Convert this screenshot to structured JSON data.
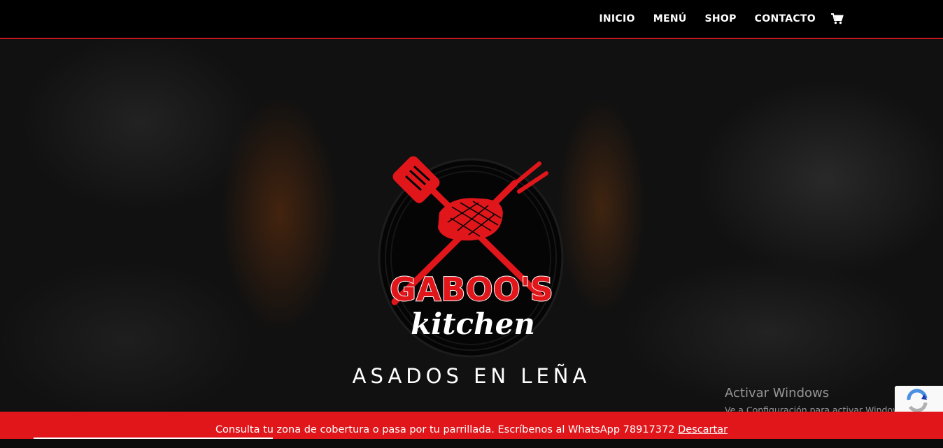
{
  "nav": {
    "items": [
      {
        "label": "INICIO"
      },
      {
        "label": "MENÚ"
      },
      {
        "label": "SHOP"
      },
      {
        "label": "CONTACTO"
      }
    ],
    "cart_icon": "cart-icon"
  },
  "hero": {
    "logo": {
      "brand_line1": "GABOO'S",
      "brand_line2": "kitchen",
      "icon": "grill-spatula-fork-steak-icon"
    },
    "tagline": "ASADOS EN LEÑA"
  },
  "watermark": {
    "title": "Activar Windows",
    "subtitle": "Ve a Configuración para activar Window"
  },
  "notice": {
    "text": "Consulta tu zona de cobertura o pasa por tu parrillada. Escríbenos al WhatsApp 78917372",
    "dismiss_label": "Descartar"
  },
  "colors": {
    "brand_red": "#e0161b",
    "header_bg": "#000000",
    "header_border": "#c4161c"
  }
}
